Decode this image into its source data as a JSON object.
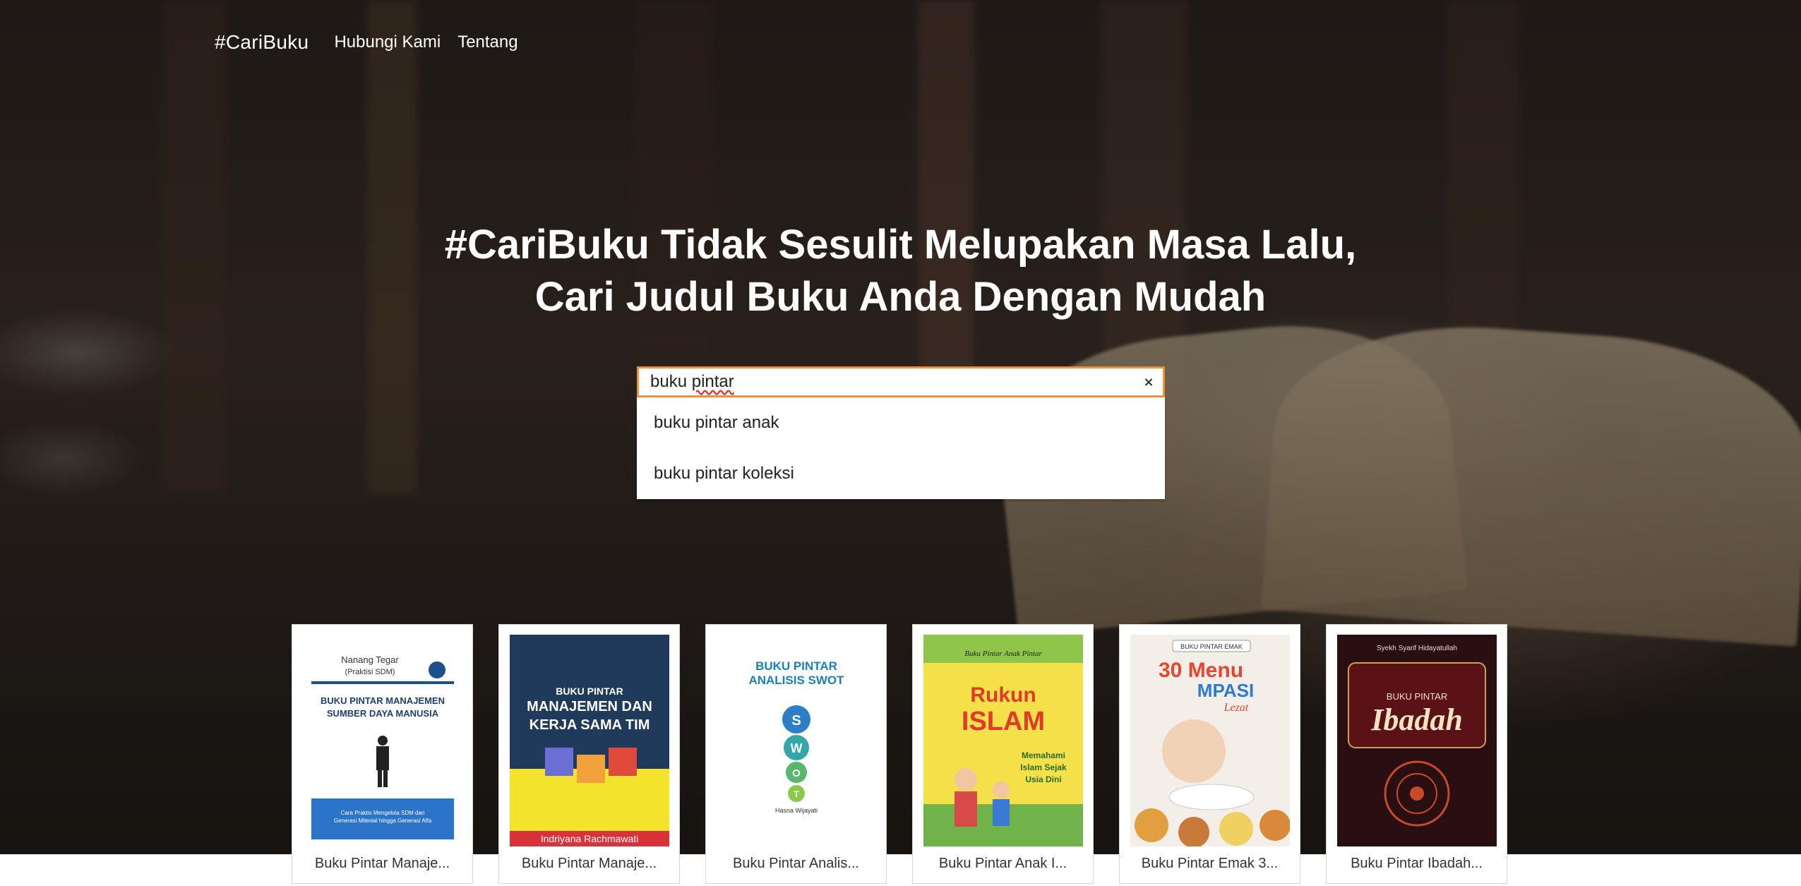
{
  "nav": {
    "brand": "#CariBuku",
    "links": [
      "Hubungi Kami",
      "Tentang"
    ]
  },
  "hero": {
    "headline_line1": "#CariBuku Tidak Sesulit Melupakan Masa Lalu,",
    "headline_line2": "Cari Judul Buku Anda Dengan Mudah"
  },
  "search": {
    "value_prefix": "buku ",
    "value_misspelled": "pintar",
    "clear_label": "×",
    "suggestions": [
      "buku pintar anak",
      "buku pintar koleksi"
    ]
  },
  "books": [
    {
      "title": "Buku Pintar Manaje...",
      "cover_author": "Nanang Tegar",
      "cover_author_sub": "(Praktisi SDM)",
      "cover_line1": "BUKU PINTAR MANAJEMEN",
      "cover_line2": "SUMBER DAYA MANUSIA",
      "cover_tagline": "Cara Praktis Mengelola SDM dari",
      "cover_tagline2": "Generasi Milenial hingga Generasi Alfa"
    },
    {
      "title": "Buku Pintar Manaje...",
      "cover_line1": "BUKU PINTAR",
      "cover_line2": "MANAJEMEN DAN",
      "cover_line3": "KERJA SAMA TIM",
      "cover_author": "Indriyana Rachmawati"
    },
    {
      "title": "Buku Pintar Analis...",
      "cover_line1": "BUKU PINTAR",
      "cover_line2": "ANALISIS SWOT",
      "cover_letters": [
        "S",
        "W",
        "O",
        "T"
      ],
      "cover_author": "Hasna Wijayati"
    },
    {
      "title": "Buku Pintar Anak I...",
      "cover_series": "Buku Pintar Anak Pintar",
      "cover_line1": "Rukun",
      "cover_line2": "ISLAM",
      "cover_sub1": "Memahami",
      "cover_sub2": "Islam Sejak",
      "cover_sub3": "Usia Dini"
    },
    {
      "title": "Buku Pintar Emak 3...",
      "cover_series": "BUKU PINTAR EMAK",
      "cover_line1": "30 Menu",
      "cover_line2": "MPASI",
      "cover_line3": "Lezat"
    },
    {
      "title": "Buku Pintar Ibadah...",
      "cover_author": "Syekh Syarif Hidayatullah",
      "cover_line1": "BUKU PINTAR",
      "cover_line2": "Ibadah"
    }
  ],
  "colors": {
    "search_border": "#f0923a",
    "text_light": "#ffffff"
  }
}
